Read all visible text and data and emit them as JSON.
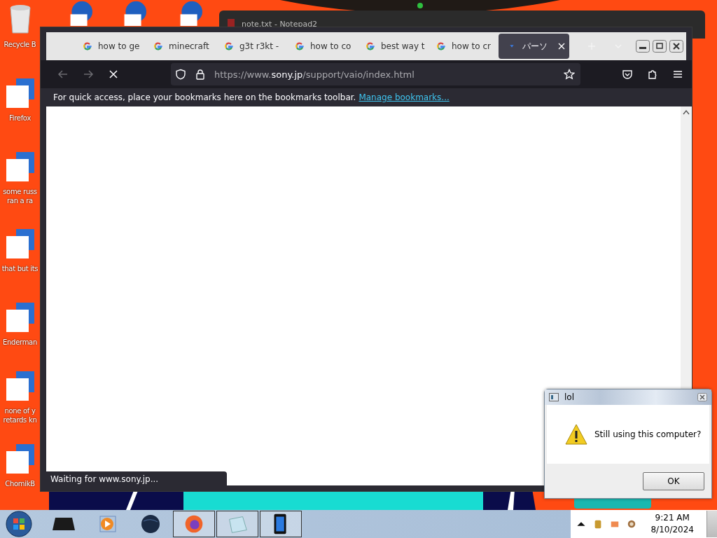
{
  "desktop_icons": [
    {
      "kind": "bin",
      "lines": [
        "Recycle B"
      ]
    },
    {
      "kind": "shortcut",
      "lines": [
        "Firefox"
      ]
    },
    {
      "kind": "shortcut",
      "lines": [
        "some russ",
        "ran a ra"
      ]
    },
    {
      "kind": "shortcut",
      "lines": [
        "that but its"
      ]
    },
    {
      "kind": "shortcut",
      "lines": [
        "Enderman"
      ]
    },
    {
      "kind": "shortcut",
      "lines": [
        "none of y",
        "retards kn"
      ]
    },
    {
      "kind": "shortcut",
      "lines": [
        "ChomikB"
      ]
    }
  ],
  "notepad_window": {
    "title": "note.txt - Notepad2"
  },
  "browser": {
    "tabs": [
      {
        "label": "how to ge",
        "kind": "google",
        "selected": false
      },
      {
        "label": "minecraft",
        "kind": "google",
        "selected": false
      },
      {
        "label": "g3t r3kt -",
        "kind": "google",
        "selected": false
      },
      {
        "label": "how to co",
        "kind": "google",
        "selected": false
      },
      {
        "label": "best way t",
        "kind": "google",
        "selected": false
      },
      {
        "label": "how to cr",
        "kind": "google",
        "selected": false
      },
      {
        "label": "パーソ",
        "kind": "loading",
        "selected": true
      }
    ],
    "url": {
      "prefix": "https://www.",
      "domain": "sony.jp",
      "path": "/support/vaio/index.html"
    },
    "bookmarks_hint": "For quick access, place your bookmarks here on the bookmarks toolbar.",
    "bookmarks_link": "Manage bookmarks...",
    "status": "Waiting for www.sony.jp..."
  },
  "dialog": {
    "title": "lol",
    "message": "Still using this computer?",
    "button": "OK"
  },
  "taskbar": {
    "time": "9:21 AM",
    "date": "8/10/2024"
  }
}
